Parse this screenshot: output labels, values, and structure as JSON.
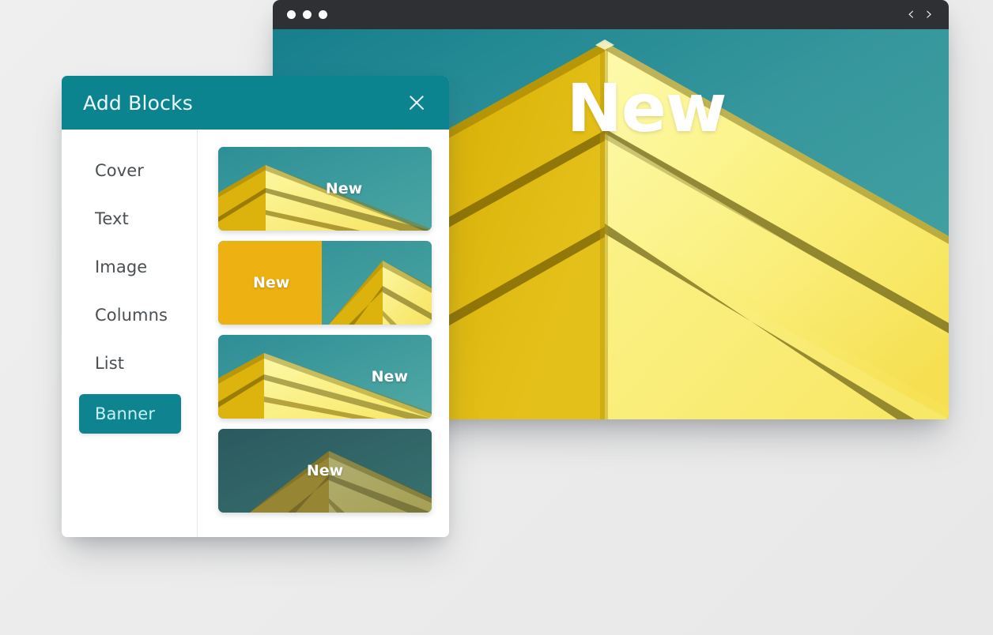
{
  "browser": {
    "window_dots": [
      "dot-1",
      "dot-2",
      "dot-3"
    ],
    "nav_prev_icon": "‹",
    "nav_next_icon": "›",
    "hero_text": "New",
    "titlebar_color": "#2e3033",
    "viewport_bg_color": "#3fa0a0"
  },
  "panel": {
    "title": "Add Blocks",
    "close_icon": "close-icon",
    "header_color": "#0b8490",
    "accent_color": "#0d8490",
    "sidebar": {
      "items": [
        {
          "label": "Cover",
          "active": false
        },
        {
          "label": "Text",
          "active": false
        },
        {
          "label": "Image",
          "active": false
        },
        {
          "label": "Columns",
          "active": false
        },
        {
          "label": "List",
          "active": false
        },
        {
          "label": "Banner",
          "active": true
        }
      ]
    },
    "cards": [
      {
        "label": "New",
        "label_position": "center-right",
        "style": "photo-full",
        "dimmed": false
      },
      {
        "label": "New",
        "label_position": "left-half",
        "style": "split-amber",
        "dimmed": false
      },
      {
        "label": "New",
        "label_position": "right",
        "style": "photo-full",
        "dimmed": false
      },
      {
        "label": "New",
        "label_position": "center",
        "style": "photo-full",
        "dimmed": true
      }
    ]
  },
  "colors": {
    "page_background": "#ebebeb",
    "teal_header": "#0b8490",
    "teal_sky": "#3fa0a0",
    "amber": "#edb211",
    "building_light": "#fbf07e",
    "building_shadow": "#d4ac06"
  }
}
